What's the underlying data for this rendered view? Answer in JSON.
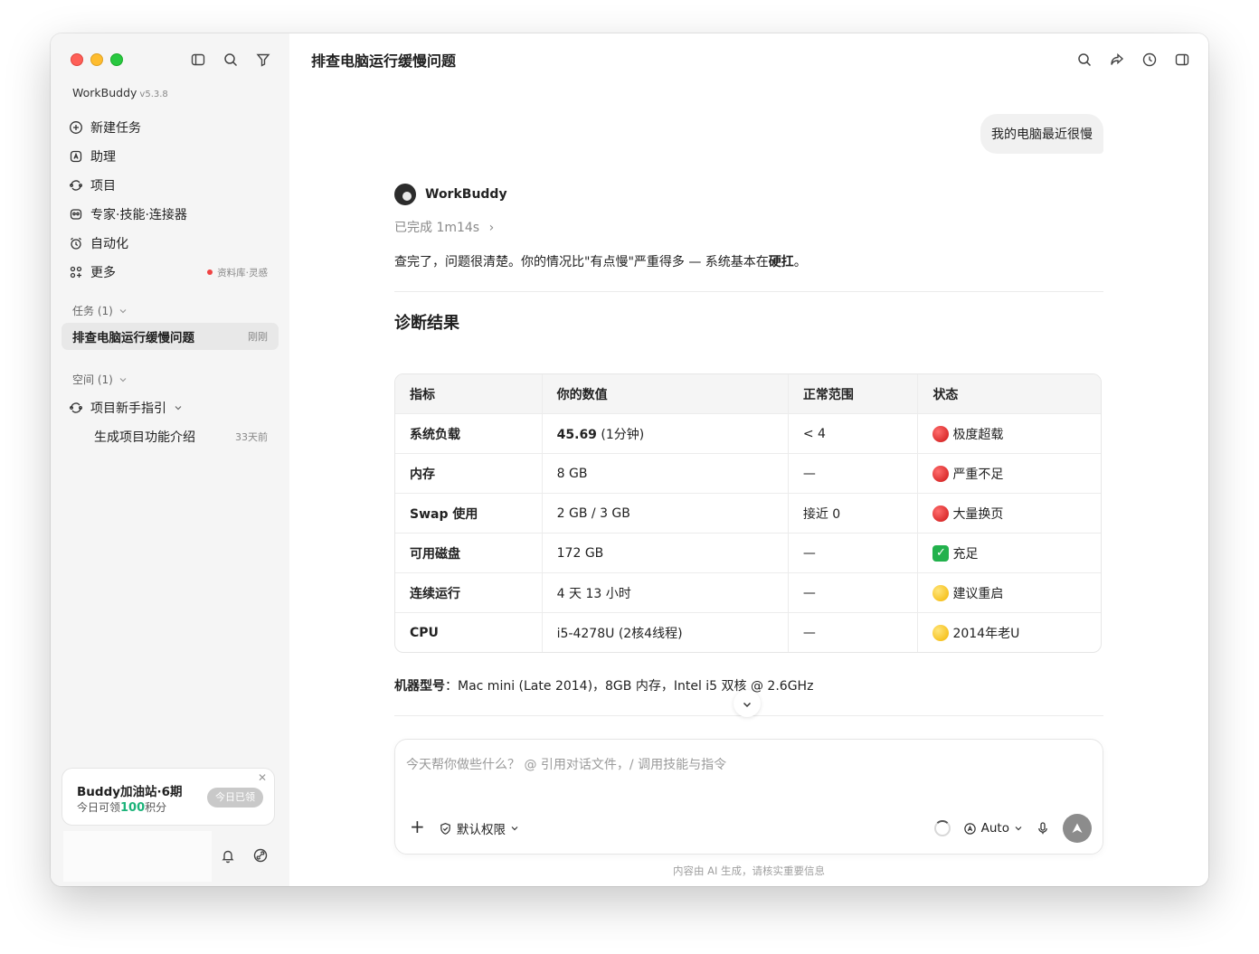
{
  "sidebar": {
    "brand": "WorkBuddy",
    "version": "v5.3.8",
    "nav": [
      {
        "label": "新建任务",
        "icon": "plus-circle-icon"
      },
      {
        "label": "助理",
        "icon": "assistant-icon"
      },
      {
        "label": "项目",
        "icon": "project-icon"
      },
      {
        "label": "专家·技能·连接器",
        "icon": "expert-icon"
      },
      {
        "label": "自动化",
        "icon": "alarm-icon"
      },
      {
        "label": "更多",
        "icon": "grid-icon",
        "extra": "资料库·灵感"
      }
    ],
    "tasks_header": "任务 (1)",
    "active_task": {
      "label": "排查电脑运行缓慢问题",
      "time": "刚刚"
    },
    "spaces_header": "空间 (1)",
    "project": {
      "label": "项目新手指引"
    },
    "project_child": {
      "label": "生成项目功能介绍",
      "time": "33天前"
    },
    "promo": {
      "title": "Buddy加油站·6期",
      "sub_prefix": "今日可领",
      "sub_number": "100",
      "sub_suffix": "积分",
      "button": "今日已领",
      "close": "✕"
    }
  },
  "main": {
    "title": "排查电脑运行缓慢问题",
    "user_message": "我的电脑最近很慢",
    "bot_name": "WorkBuddy",
    "status": "已完成 1m14s",
    "status_chevron": "›",
    "intro_text": "查完了，问题很清楚。你的情况比\"有点慢\"严重得多 — 系统基本在",
    "intro_bold": "硬扛",
    "intro_end": "。",
    "heading": "诊断结果",
    "table": {
      "headers": [
        "指标",
        "你的数值",
        "正常范围",
        "状态"
      ],
      "rows": [
        {
          "metric": "系统负载",
          "value_bold": "45.69",
          "value": " (1分钟)",
          "range": "< 4",
          "status": "极度超载",
          "status_type": "red"
        },
        {
          "metric": "内存",
          "value_bold": "",
          "value": "8 GB",
          "range": "—",
          "status": "严重不足",
          "status_type": "red"
        },
        {
          "metric": "Swap 使用",
          "value_bold": "",
          "value": "2 GB / 3 GB",
          "range": "接近 0",
          "status": "大量换页",
          "status_type": "red"
        },
        {
          "metric": "可用磁盘",
          "value_bold": "",
          "value": "172 GB",
          "range": "—",
          "status": "充足",
          "status_type": "check"
        },
        {
          "metric": "连续运行",
          "value_bold": "",
          "value": "4 天 13 小时",
          "range": "—",
          "status": "建议重启",
          "status_type": "yellow"
        },
        {
          "metric": "CPU",
          "value_bold": "",
          "value": "i5-4278U (2核4线程)",
          "range": "—",
          "status": "2014年老U",
          "status_type": "yellow"
        }
      ]
    },
    "machine_label": "机器型号",
    "machine_value": "：Mac mini (Late 2014)，8GB 内存，Intel i5 双核 @ 2.6GHz",
    "composer": {
      "placeholder": "今天帮你做些什么？ @ 引用对话文件，/ 调用技能与指令",
      "permission": "默认权限",
      "model": "Auto"
    },
    "disclaimer": "内容由 AI 生成，请核实重要信息"
  },
  "colors": {
    "sidebar_bg": "#f5f5f5",
    "accent_green": "#1cb37a",
    "status_red": "#e02020",
    "status_yellow": "#f5c400",
    "status_check": "#22b14c"
  }
}
